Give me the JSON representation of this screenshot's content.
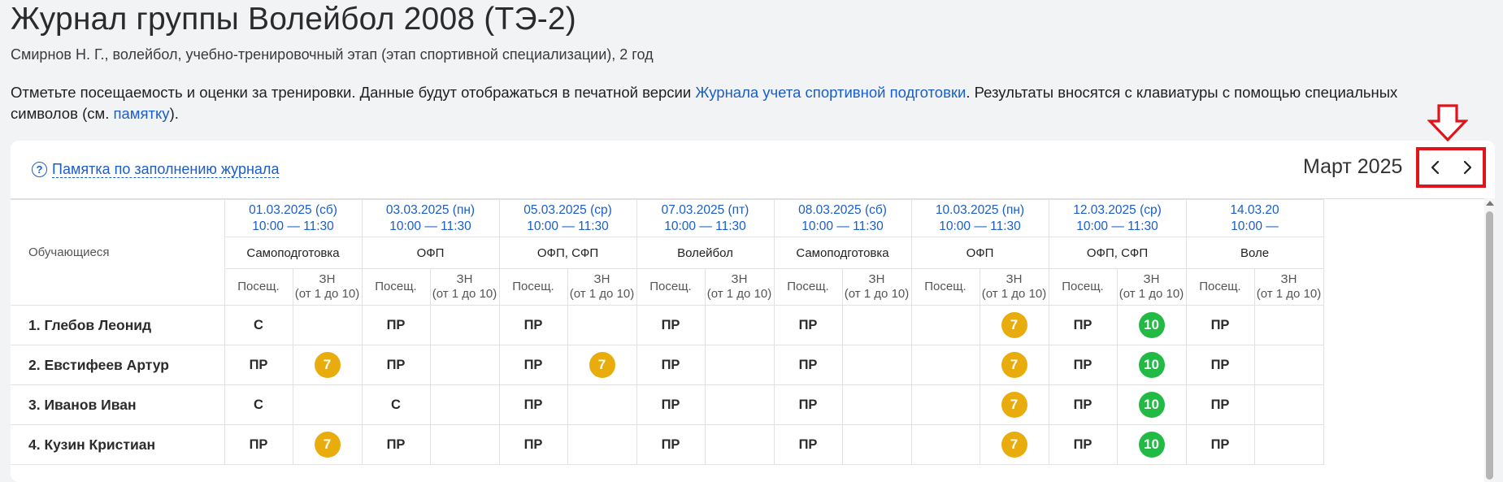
{
  "header": {
    "title": "Журнал группы Волейбол 2008 (ТЭ-2)",
    "subtitle": "Смирнов Н. Г., волейбол, учебно-тренировочный этап (этап спортивной специализации), 2 год"
  },
  "intro": {
    "part1": "Отметьте посещаемость и оценки за тренировки. Данные будут отображаться в печатной версии ",
    "link1": "Журнала учета спортивной подготовки",
    "part2": ". Результаты вносятся с клавиатуры с помощью специальных символов (см. ",
    "link2": "памятку",
    "part3": ")."
  },
  "toolbar": {
    "memo_icon": "?",
    "memo_label": "Памятка по заполнению журнала",
    "month": "Март 2025"
  },
  "icons": {
    "prev": "chevron-left-icon",
    "next": "chevron-right-icon",
    "annotation": "arrow-down-icon"
  },
  "colors": {
    "link": "#1a5ec9",
    "highlight": "#e0141b",
    "badge_gold": "#e8ac0c",
    "badge_green": "#21ba45"
  },
  "table": {
    "students_header": "Обучающиеся",
    "sessions": [
      {
        "date": "01.03.2025 (сб)",
        "time": "10:00 — 11:30",
        "type": "Самоподготовка"
      },
      {
        "date": "03.03.2025 (пн)",
        "time": "10:00 — 11:30",
        "type": "ОФП"
      },
      {
        "date": "05.03.2025 (ср)",
        "time": "10:00 — 11:30",
        "type": "ОФП, СФП"
      },
      {
        "date": "07.03.2025 (пт)",
        "time": "10:00 — 11:30",
        "type": "Волейбол"
      },
      {
        "date": "08.03.2025 (сб)",
        "time": "10:00 — 11:30",
        "type": "Самоподготовка"
      },
      {
        "date": "10.03.2025 (пн)",
        "time": "10:00 — 11:30",
        "type": "ОФП"
      },
      {
        "date": "12.03.2025 (ср)",
        "time": "10:00 — 11:30",
        "type": "ОФП, СФП"
      },
      {
        "date": "14.03.20",
        "time": "10:00 —",
        "type": "Воле"
      }
    ],
    "sub_attendance": "Посещ.",
    "sub_grade_line1": "ЗН",
    "sub_grade_line2": "(от 1 до 10)",
    "students": [
      {
        "name": "1. Глебов Леонид",
        "cells": [
          {
            "att": "С",
            "grade": ""
          },
          {
            "att": "ПР",
            "grade": ""
          },
          {
            "att": "ПР",
            "grade": ""
          },
          {
            "att": "ПР",
            "grade": ""
          },
          {
            "att": "ПР",
            "grade": ""
          },
          {
            "att": "",
            "grade": "7"
          },
          {
            "att": "ПР",
            "grade": "10"
          },
          {
            "att": "ПР",
            "grade": ""
          }
        ]
      },
      {
        "name": "2. Евстифеев Артур",
        "cells": [
          {
            "att": "ПР",
            "grade": "7"
          },
          {
            "att": "ПР",
            "grade": ""
          },
          {
            "att": "ПР",
            "grade": "7"
          },
          {
            "att": "ПР",
            "grade": ""
          },
          {
            "att": "ПР",
            "grade": ""
          },
          {
            "att": "",
            "grade": "7"
          },
          {
            "att": "ПР",
            "grade": "10"
          },
          {
            "att": "ПР",
            "grade": ""
          }
        ]
      },
      {
        "name": "3. Иванов Иван",
        "cells": [
          {
            "att": "С",
            "grade": ""
          },
          {
            "att": "С",
            "grade": ""
          },
          {
            "att": "ПР",
            "grade": ""
          },
          {
            "att": "ПР",
            "grade": ""
          },
          {
            "att": "ПР",
            "grade": ""
          },
          {
            "att": "",
            "grade": "7"
          },
          {
            "att": "ПР",
            "grade": "10"
          },
          {
            "att": "ПР",
            "grade": ""
          }
        ]
      },
      {
        "name": "4. Кузин Кристиан",
        "cells": [
          {
            "att": "ПР",
            "grade": "7"
          },
          {
            "att": "ПР",
            "grade": ""
          },
          {
            "att": "ПР",
            "grade": ""
          },
          {
            "att": "ПР",
            "grade": ""
          },
          {
            "att": "ПР",
            "grade": ""
          },
          {
            "att": "",
            "grade": "7"
          },
          {
            "att": "ПР",
            "grade": "10"
          },
          {
            "att": "ПР",
            "grade": ""
          }
        ]
      }
    ]
  }
}
